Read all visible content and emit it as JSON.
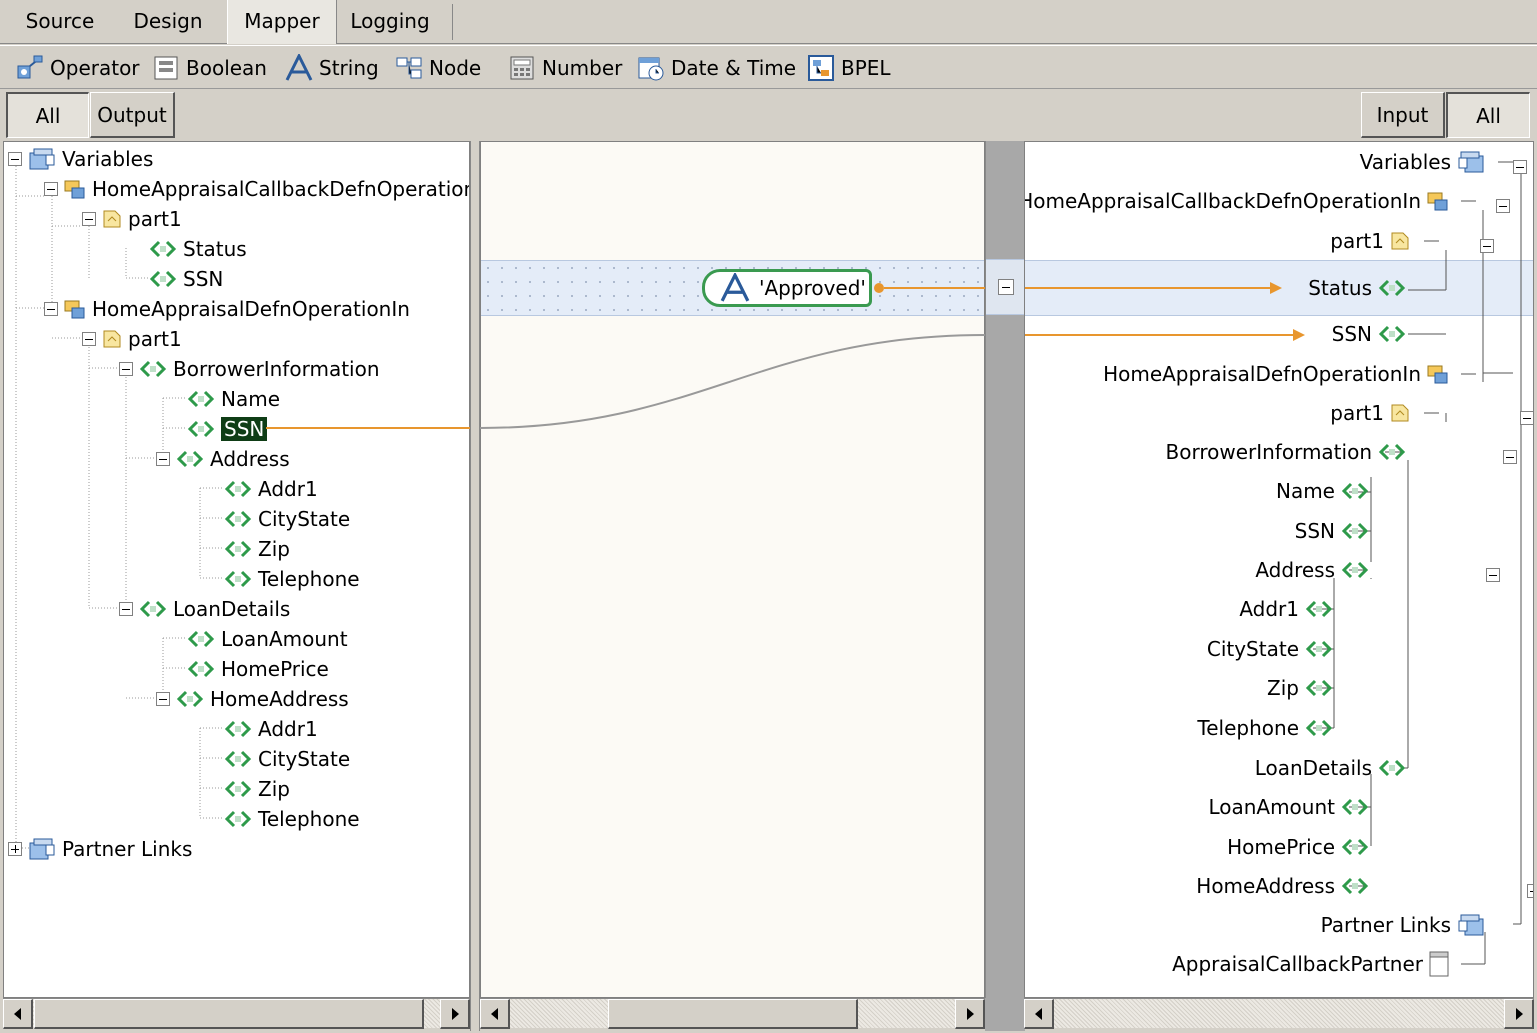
{
  "tabs": [
    {
      "label": "Source"
    },
    {
      "label": "Design"
    },
    {
      "label": "Mapper",
      "active": true
    },
    {
      "label": "Logging"
    }
  ],
  "toolbar": {
    "operator": "Operator",
    "boolean": "Boolean",
    "string": "String",
    "node": "Node",
    "number": "Number",
    "datetime": "Date & Time",
    "bpel": "BPEL"
  },
  "filters": {
    "left_all": "All",
    "left_output": "Output",
    "right_input": "Input",
    "right_all": "All"
  },
  "left_tree": {
    "variables": "Variables",
    "callback_op": "HomeAppraisalCallbackDefnOperationIn",
    "part1_a": "part1",
    "status": "Status",
    "ssn_a": "SSN",
    "defn_op": "HomeAppraisalDefnOperationIn",
    "part1_b": "part1",
    "borrower": "BorrowerInformation",
    "name": "Name",
    "ssn_b": "SSN",
    "address": "Address",
    "addr1": "Addr1",
    "citystate": "CityState",
    "zip": "Zip",
    "telephone": "Telephone",
    "loan": "LoanDetails",
    "loan_amount": "LoanAmount",
    "home_price": "HomePrice",
    "home_address": "HomeAddress",
    "ha_addr1": "Addr1",
    "ha_citystate": "CityState",
    "ha_zip": "Zip",
    "ha_telephone": "Telephone",
    "partner_links": "Partner Links"
  },
  "mapper": {
    "string_literal": "'Approved'"
  },
  "right_tree": {
    "variables": "Variables",
    "callback_op": "HomeAppraisalCallbackDefnOperationIn",
    "part1_a": "part1",
    "status": "Status",
    "ssn_a": "SSN",
    "defn_op": "HomeAppraisalDefnOperationIn",
    "part1_b": "part1",
    "borrower": "BorrowerInformation",
    "name": "Name",
    "ssn_b": "SSN",
    "address": "Address",
    "addr1": "Addr1",
    "citystate": "CityState",
    "zip": "Zip",
    "telephone": "Telephone",
    "loan": "LoanDetails",
    "loan_amount": "LoanAmount",
    "home_price": "HomePrice",
    "home_address": "HomeAddress",
    "partner_links": "Partner Links",
    "appraisal_partner": "AppraisalCallbackPartner"
  },
  "colors": {
    "link_orange": "#e8962e",
    "element_green": "#2e9a4a",
    "highlight": "#0f3d16"
  }
}
